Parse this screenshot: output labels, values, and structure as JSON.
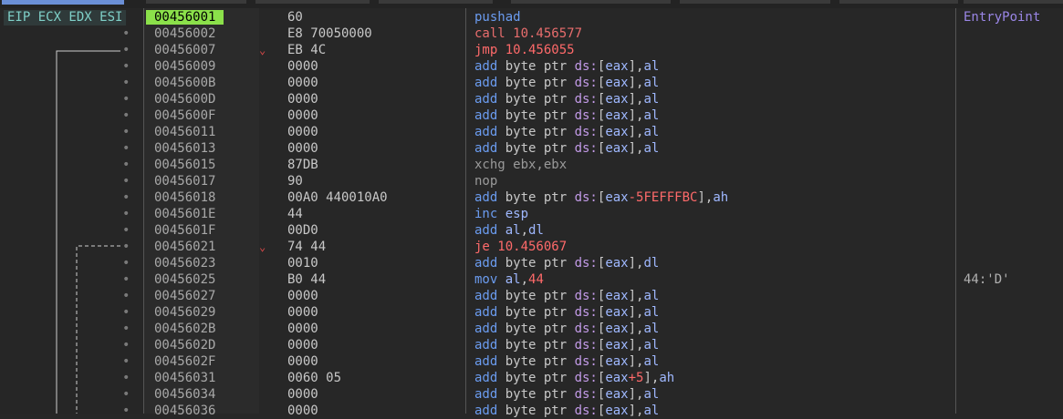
{
  "register_label": "EIP ECX EDX ESI",
  "rows": [
    {
      "addr": "00456001",
      "bytes": "60",
      "instr": [
        [
          "pushad",
          "mn"
        ]
      ],
      "comment": "EntryPoint",
      "current": true
    },
    {
      "addr": "00456002",
      "bytes": "E8 70050000",
      "instr": [
        [
          "call 10.456577",
          "call"
        ]
      ]
    },
    {
      "addr": "00456007",
      "bytes": "EB 4C",
      "arrow": true,
      "instr": [
        [
          "jmp 10.456055",
          "jmp"
        ]
      ]
    },
    {
      "addr": "00456009",
      "bytes": "0000",
      "instr": [
        [
          "add ",
          "mn"
        ],
        [
          "byte ptr ",
          "sz"
        ],
        [
          "ds:",
          "seg"
        ],
        [
          "[",
          "punc"
        ],
        [
          "eax",
          "reg"
        ],
        [
          "],",
          "punc"
        ],
        [
          "al",
          "reg"
        ]
      ]
    },
    {
      "addr": "0045600B",
      "bytes": "0000",
      "instr": [
        [
          "add ",
          "mn"
        ],
        [
          "byte ptr ",
          "sz"
        ],
        [
          "ds:",
          "seg"
        ],
        [
          "[",
          "punc"
        ],
        [
          "eax",
          "reg"
        ],
        [
          "],",
          "punc"
        ],
        [
          "al",
          "reg"
        ]
      ]
    },
    {
      "addr": "0045600D",
      "bytes": "0000",
      "instr": [
        [
          "add ",
          "mn"
        ],
        [
          "byte ptr ",
          "sz"
        ],
        [
          "ds:",
          "seg"
        ],
        [
          "[",
          "punc"
        ],
        [
          "eax",
          "reg"
        ],
        [
          "],",
          "punc"
        ],
        [
          "al",
          "reg"
        ]
      ]
    },
    {
      "addr": "0045600F",
      "bytes": "0000",
      "instr": [
        [
          "add ",
          "mn"
        ],
        [
          "byte ptr ",
          "sz"
        ],
        [
          "ds:",
          "seg"
        ],
        [
          "[",
          "punc"
        ],
        [
          "eax",
          "reg"
        ],
        [
          "],",
          "punc"
        ],
        [
          "al",
          "reg"
        ]
      ]
    },
    {
      "addr": "00456011",
      "bytes": "0000",
      "instr": [
        [
          "add ",
          "mn"
        ],
        [
          "byte ptr ",
          "sz"
        ],
        [
          "ds:",
          "seg"
        ],
        [
          "[",
          "punc"
        ],
        [
          "eax",
          "reg"
        ],
        [
          "],",
          "punc"
        ],
        [
          "al",
          "reg"
        ]
      ]
    },
    {
      "addr": "00456013",
      "bytes": "0000",
      "instr": [
        [
          "add ",
          "mn"
        ],
        [
          "byte ptr ",
          "sz"
        ],
        [
          "ds:",
          "seg"
        ],
        [
          "[",
          "punc"
        ],
        [
          "eax",
          "reg"
        ],
        [
          "],",
          "punc"
        ],
        [
          "al",
          "reg"
        ]
      ]
    },
    {
      "addr": "00456015",
      "bytes": "87DB",
      "instr": [
        [
          "xchg ebx,ebx",
          "grey"
        ]
      ]
    },
    {
      "addr": "00456017",
      "bytes": "90",
      "instr": [
        [
          "nop",
          "grey"
        ]
      ]
    },
    {
      "addr": "00456018",
      "bytes": "00A0 440010A0",
      "instr": [
        [
          "add ",
          "mn"
        ],
        [
          "byte ptr ",
          "sz"
        ],
        [
          "ds:",
          "seg"
        ],
        [
          "[",
          "punc"
        ],
        [
          "eax",
          "reg"
        ],
        [
          "-5FEFFFBC",
          "num"
        ],
        [
          "],",
          "punc"
        ],
        [
          "ah",
          "reg"
        ]
      ]
    },
    {
      "addr": "0045601E",
      "bytes": "44",
      "instr": [
        [
          "inc ",
          "mn"
        ],
        [
          "esp",
          "reg"
        ]
      ]
    },
    {
      "addr": "0045601F",
      "bytes": "00D0",
      "instr": [
        [
          "add ",
          "mn"
        ],
        [
          "al",
          "reg"
        ],
        [
          ",",
          "punc"
        ],
        [
          "dl",
          "reg"
        ]
      ]
    },
    {
      "addr": "00456021",
      "bytes": "74 44",
      "arrow": true,
      "instr": [
        [
          "je 10.456067",
          "je"
        ]
      ]
    },
    {
      "addr": "00456023",
      "bytes": "0010",
      "instr": [
        [
          "add ",
          "mn"
        ],
        [
          "byte ptr ",
          "sz"
        ],
        [
          "ds:",
          "seg"
        ],
        [
          "[",
          "punc"
        ],
        [
          "eax",
          "reg"
        ],
        [
          "],",
          "punc"
        ],
        [
          "dl",
          "reg"
        ]
      ]
    },
    {
      "addr": "00456025",
      "bytes": "B0 44",
      "instr": [
        [
          "mov ",
          "mn"
        ],
        [
          "al",
          "reg"
        ],
        [
          ",",
          "punc"
        ],
        [
          "44",
          "num"
        ]
      ],
      "comment": "44:'D'"
    },
    {
      "addr": "00456027",
      "bytes": "0000",
      "instr": [
        [
          "add ",
          "mn"
        ],
        [
          "byte ptr ",
          "sz"
        ],
        [
          "ds:",
          "seg"
        ],
        [
          "[",
          "punc"
        ],
        [
          "eax",
          "reg"
        ],
        [
          "],",
          "punc"
        ],
        [
          "al",
          "reg"
        ]
      ]
    },
    {
      "addr": "00456029",
      "bytes": "0000",
      "instr": [
        [
          "add ",
          "mn"
        ],
        [
          "byte ptr ",
          "sz"
        ],
        [
          "ds:",
          "seg"
        ],
        [
          "[",
          "punc"
        ],
        [
          "eax",
          "reg"
        ],
        [
          "],",
          "punc"
        ],
        [
          "al",
          "reg"
        ]
      ]
    },
    {
      "addr": "0045602B",
      "bytes": "0000",
      "instr": [
        [
          "add ",
          "mn"
        ],
        [
          "byte ptr ",
          "sz"
        ],
        [
          "ds:",
          "seg"
        ],
        [
          "[",
          "punc"
        ],
        [
          "eax",
          "reg"
        ],
        [
          "],",
          "punc"
        ],
        [
          "al",
          "reg"
        ]
      ]
    },
    {
      "addr": "0045602D",
      "bytes": "0000",
      "instr": [
        [
          "add ",
          "mn"
        ],
        [
          "byte ptr ",
          "sz"
        ],
        [
          "ds:",
          "seg"
        ],
        [
          "[",
          "punc"
        ],
        [
          "eax",
          "reg"
        ],
        [
          "],",
          "punc"
        ],
        [
          "al",
          "reg"
        ]
      ]
    },
    {
      "addr": "0045602F",
      "bytes": "0000",
      "instr": [
        [
          "add ",
          "mn"
        ],
        [
          "byte ptr ",
          "sz"
        ],
        [
          "ds:",
          "seg"
        ],
        [
          "[",
          "punc"
        ],
        [
          "eax",
          "reg"
        ],
        [
          "],",
          "punc"
        ],
        [
          "al",
          "reg"
        ]
      ]
    },
    {
      "addr": "00456031",
      "bytes": "0060 05",
      "instr": [
        [
          "add ",
          "mn"
        ],
        [
          "byte ptr ",
          "sz"
        ],
        [
          "ds:",
          "seg"
        ],
        [
          "[",
          "punc"
        ],
        [
          "eax",
          "reg"
        ],
        [
          "+5",
          "num"
        ],
        [
          "],",
          "punc"
        ],
        [
          "ah",
          "reg"
        ]
      ]
    },
    {
      "addr": "00456034",
      "bytes": "0000",
      "instr": [
        [
          "add ",
          "mn"
        ],
        [
          "byte ptr ",
          "sz"
        ],
        [
          "ds:",
          "seg"
        ],
        [
          "[",
          "punc"
        ],
        [
          "eax",
          "reg"
        ],
        [
          "],",
          "punc"
        ],
        [
          "al",
          "reg"
        ]
      ]
    },
    {
      "addr": "00456036",
      "bytes": "0000",
      "instr": [
        [
          "add ",
          "mn"
        ],
        [
          "byte ptr ",
          "sz"
        ],
        [
          "ds:",
          "seg"
        ],
        [
          "[",
          "punc"
        ],
        [
          "eax",
          "reg"
        ],
        [
          "],",
          "punc"
        ],
        [
          "al",
          "reg"
        ]
      ]
    }
  ]
}
